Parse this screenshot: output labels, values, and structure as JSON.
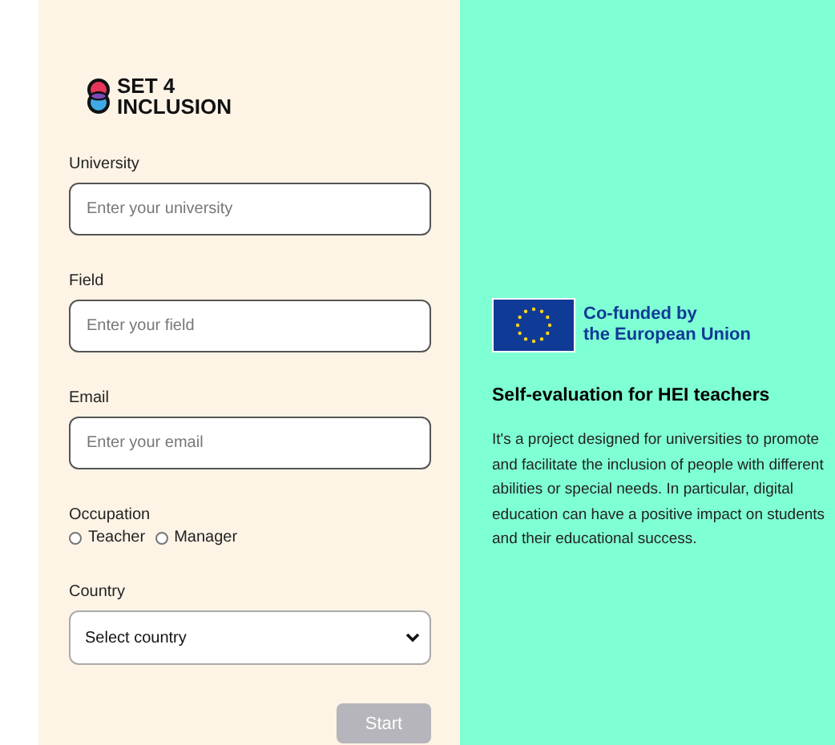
{
  "logo": {
    "line1": "SET 4",
    "line2": "INCLUSION"
  },
  "form": {
    "fields": [
      {
        "label": "University",
        "placeholder": "Enter your university"
      },
      {
        "label": "Field",
        "placeholder": "Enter your field"
      },
      {
        "label": "Email",
        "placeholder": "Enter your email"
      }
    ],
    "occupation": {
      "label": "Occupation",
      "options": [
        {
          "label": "Teacher",
          "selected": false
        },
        {
          "label": "Manager",
          "selected": false
        }
      ]
    },
    "country": {
      "label": "Country",
      "placeholder": "Select country"
    },
    "start_button": {
      "label": "Start",
      "disabled": true
    }
  },
  "info": {
    "funding": {
      "line1": "Co-funded by",
      "line2": "the European Union"
    },
    "title": "Self-evaluation for HEI teachers",
    "description": "It's a project designed for universities to promote and facilitate the inclusion of people with different abilities or special needs. In particular, digital education can have a positive impact on students and their educational success."
  }
}
